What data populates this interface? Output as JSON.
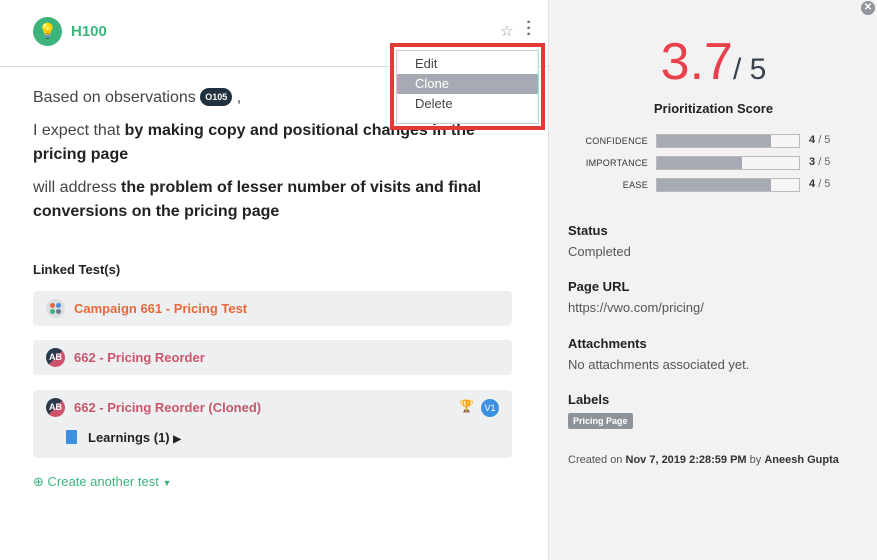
{
  "hypothesis": {
    "id": "H100",
    "icon": "lightbulb-icon"
  },
  "menu": {
    "items": [
      "Edit",
      "Clone",
      "Delete"
    ],
    "selected": "Clone"
  },
  "body": {
    "line1_prefix": "Based on observations",
    "observation": "O105",
    "line1_suffix": ",",
    "line2_prefix": "I expect that",
    "line2_bold": "by making copy and positional changes in the pricing page",
    "line3_prefix": "will address",
    "line3_bold": "the problem of lesser number of visits and final conversions on the pricing page"
  },
  "linked": {
    "title": "Linked Test(s)",
    "tests": [
      {
        "name": "Campaign 661 - Pricing Test",
        "color": "#e8683a"
      },
      {
        "name": "662 - Pricing Reorder",
        "color": "#c9566a"
      },
      {
        "name": "662 - Pricing Reorder (Cloned)",
        "color": "#c9566a",
        "badge": "V1",
        "learnings": "Learnings (1)"
      }
    ],
    "create": "Create another test"
  },
  "score": {
    "value": "3.7",
    "max": "/ 5",
    "title": "Prioritization Score",
    "metrics": [
      {
        "label": "CONFIDENCE",
        "value": "4",
        "max": "/ 5",
        "fraction": 0.8
      },
      {
        "label": "IMPORTANCE",
        "value": "3",
        "max": "/ 5",
        "fraction": 0.6
      },
      {
        "label": "EASE",
        "value": "4",
        "max": "/ 5",
        "fraction": 0.8
      }
    ]
  },
  "details": {
    "status_label": "Status",
    "status": "Completed",
    "url_label": "Page URL",
    "url": "https://vwo.com/pricing/",
    "attach_label": "Attachments",
    "attach": "No attachments associated yet.",
    "labels_label": "Labels",
    "label": "Pricing Page",
    "created_prefix": "Created on",
    "created_date": "Nov 7, 2019 2:28:59 PM",
    "created_by": "by",
    "author": "Aneesh Gupta"
  }
}
